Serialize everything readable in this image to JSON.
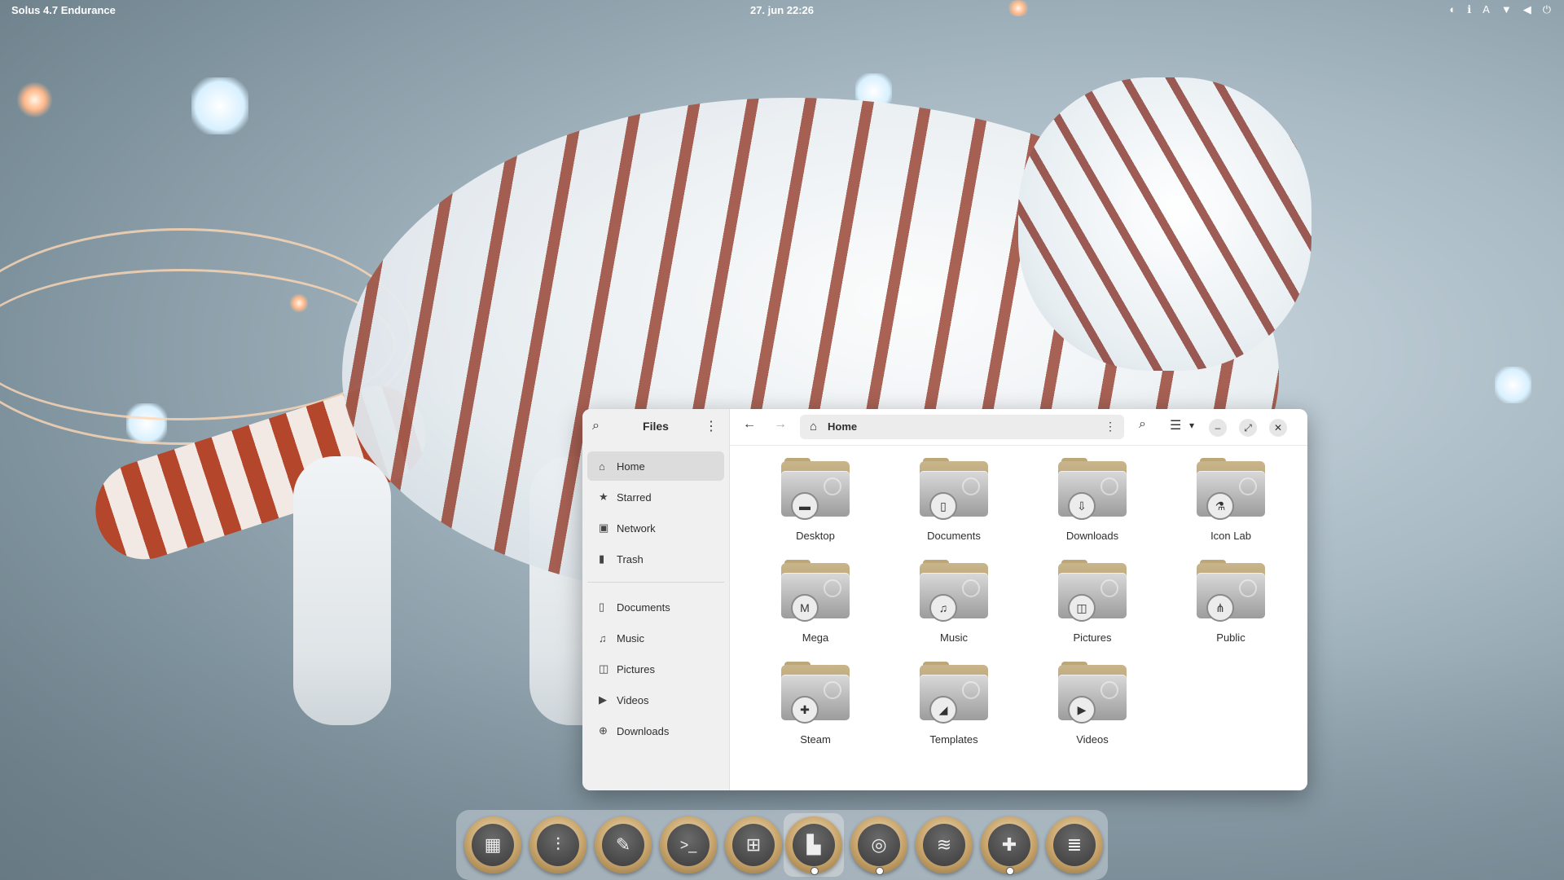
{
  "top_panel": {
    "distro_label": "Solus 4.7 Endurance",
    "clock": "27. jun  22:26",
    "tray_icons": [
      "steam-icon",
      "info-icon",
      "keyboard-icon",
      "wifi-icon",
      "volume-icon",
      "power-icon"
    ]
  },
  "files_window": {
    "sidebar": {
      "title": "Files",
      "places": [
        {
          "label": "Home",
          "icon": "home-icon",
          "active": true
        },
        {
          "label": "Starred",
          "icon": "star-icon"
        },
        {
          "label": "Network",
          "icon": "network-icon"
        },
        {
          "label": "Trash",
          "icon": "trash-icon"
        }
      ],
      "bookmarks": [
        {
          "label": "Documents",
          "icon": "document-icon"
        },
        {
          "label": "Music",
          "icon": "music-icon"
        },
        {
          "label": "Pictures",
          "icon": "pictures-icon"
        },
        {
          "label": "Videos",
          "icon": "play-icon"
        },
        {
          "label": "Downloads",
          "icon": "download-icon"
        }
      ]
    },
    "path": "Home",
    "folders": [
      {
        "label": "Desktop",
        "icon": "desktop-icon"
      },
      {
        "label": "Documents",
        "icon": "document-icon"
      },
      {
        "label": "Downloads",
        "icon": "download-icon"
      },
      {
        "label": "Icon Lab",
        "icon": "flask-icon"
      },
      {
        "label": "Mega",
        "icon": "mega-icon"
      },
      {
        "label": "Music",
        "icon": "music-icon"
      },
      {
        "label": "Pictures",
        "icon": "pictures-icon"
      },
      {
        "label": "Public",
        "icon": "share-icon"
      },
      {
        "label": "Steam",
        "icon": "gamepad-icon"
      },
      {
        "label": "Templates",
        "icon": "templates-icon"
      },
      {
        "label": "Videos",
        "icon": "play-icon"
      }
    ]
  },
  "dock": {
    "items": [
      {
        "name": "app-grid-icon",
        "running": false
      },
      {
        "name": "mixer-icon",
        "running": false
      },
      {
        "name": "tweaks-icon",
        "running": false
      },
      {
        "name": "terminal-icon",
        "running": false
      },
      {
        "name": "software-center-icon",
        "running": false
      },
      {
        "name": "files-icon",
        "running": true,
        "active": true
      },
      {
        "name": "chrome-icon",
        "running": true
      },
      {
        "name": "spotify-icon",
        "running": false
      },
      {
        "name": "games-icon",
        "running": true
      },
      {
        "name": "layers-icon",
        "running": false
      }
    ]
  }
}
